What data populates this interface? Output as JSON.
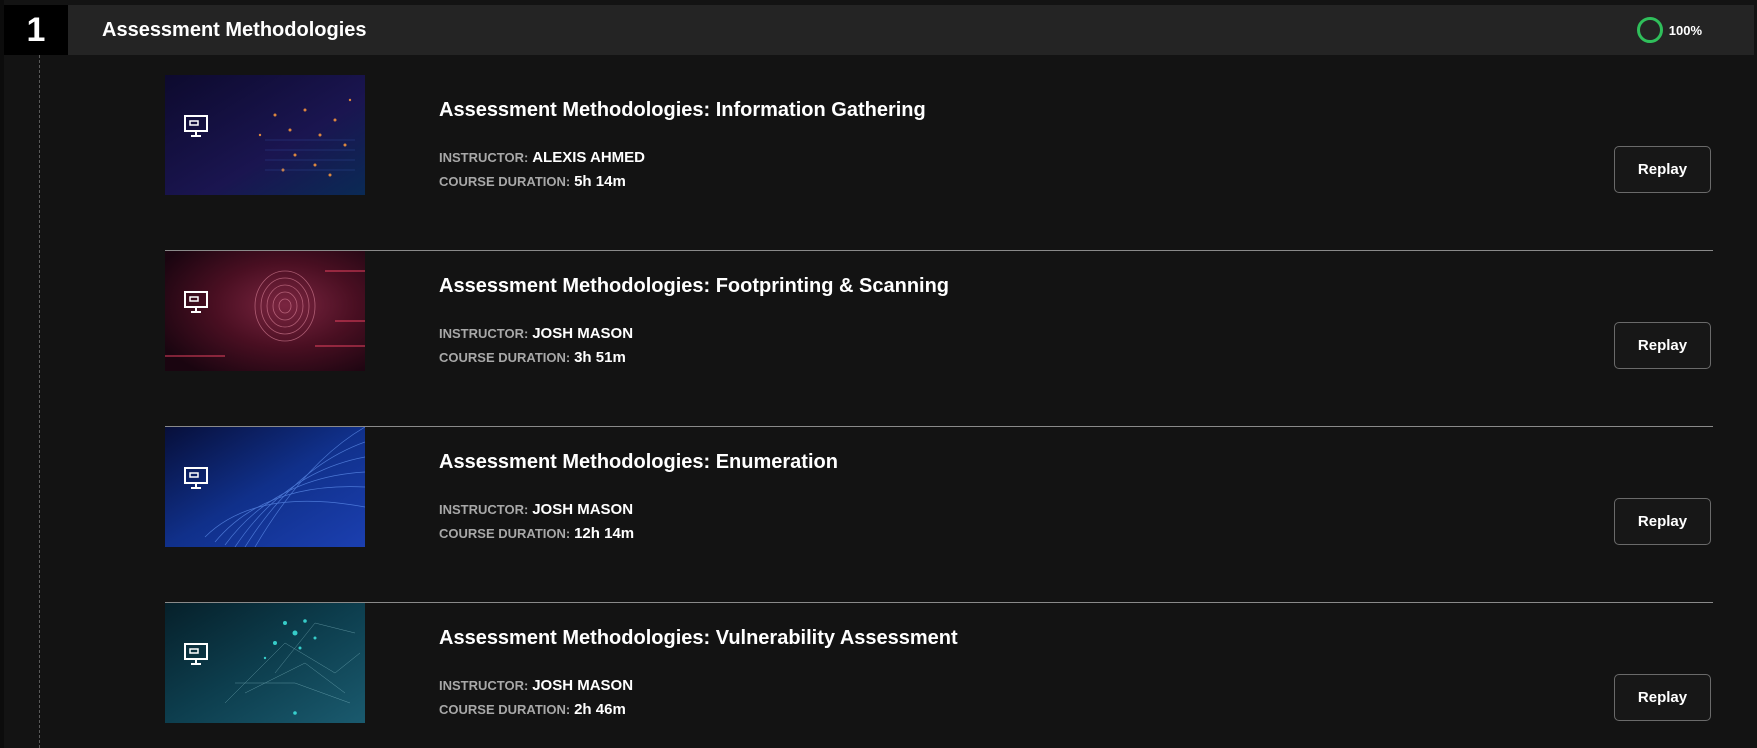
{
  "section": {
    "number": "1",
    "title": "Assessment Methodologies",
    "progress": "100%",
    "progress_value": 1.0,
    "progress_color": "#2fbf5b"
  },
  "labels": {
    "instructor": "INSTRUCTOR:",
    "duration": "COURSE DURATION:"
  },
  "courses": [
    {
      "title": "Assessment Methodologies: Information Gathering",
      "instructor": "ALEXIS AHMED",
      "duration": "5h 14m",
      "action": "Replay",
      "thumb_icon": "presentation-icon"
    },
    {
      "title": "Assessment Methodologies: Footprinting & Scanning",
      "instructor": "JOSH MASON",
      "duration": "3h 51m",
      "action": "Replay",
      "thumb_icon": "presentation-icon"
    },
    {
      "title": "Assessment Methodologies: Enumeration",
      "instructor": "JOSH MASON",
      "duration": "12h 14m",
      "action": "Replay",
      "thumb_icon": "presentation-icon"
    },
    {
      "title": "Assessment Methodologies: Vulnerability Assessment",
      "instructor": "JOSH MASON",
      "duration": "2h 46m",
      "action": "Replay",
      "thumb_icon": "presentation-icon"
    }
  ]
}
